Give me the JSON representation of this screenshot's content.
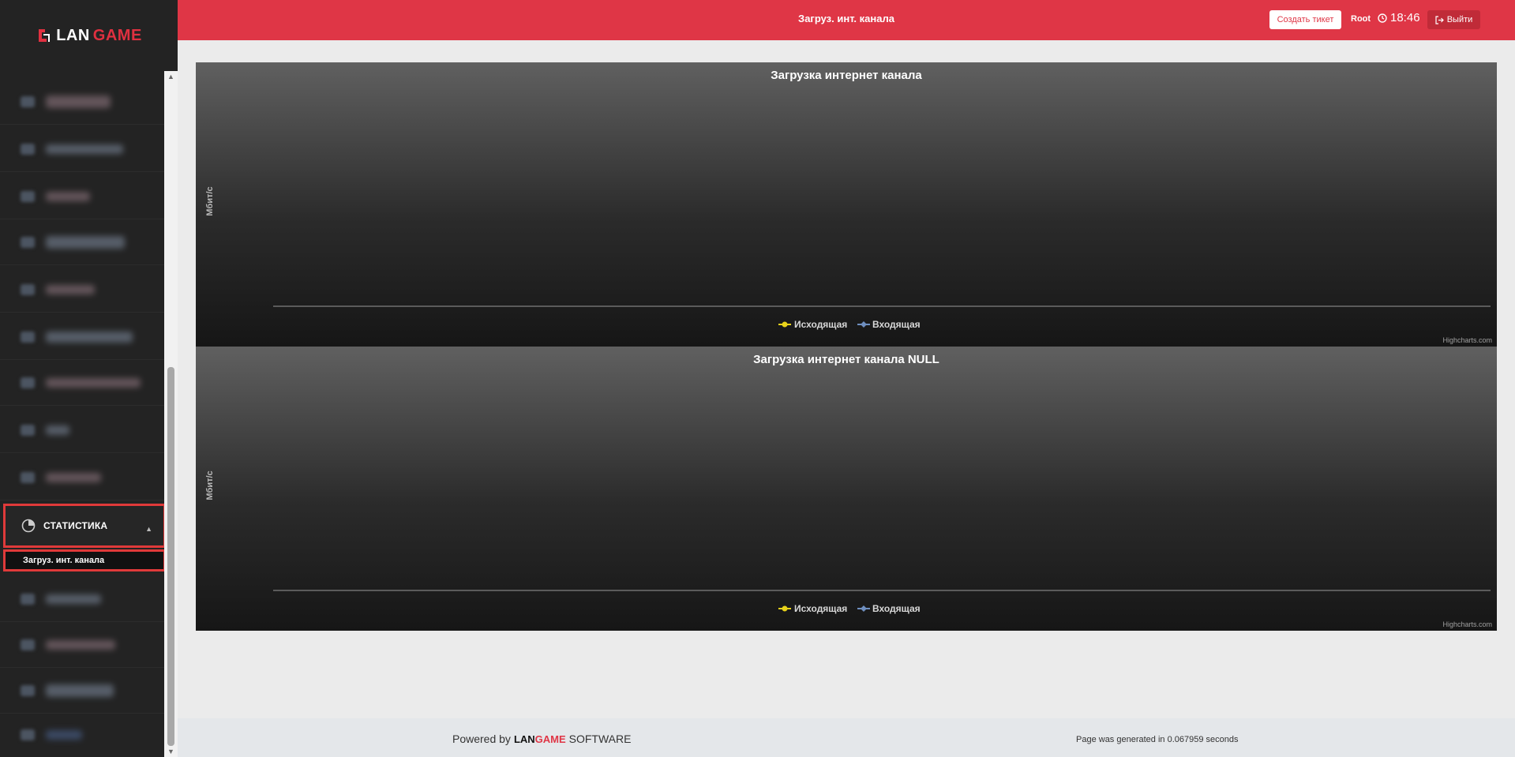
{
  "brand": {
    "lan": "LAN",
    "game": "GAME"
  },
  "header": {
    "title": "Загруз. инт. канала",
    "ticket_button": "Создать тикет",
    "user": "Root",
    "time": "18:46",
    "logout_button": "Выйти"
  },
  "sidebar": {
    "blurred_items": 9,
    "active_section": "СТАТИСТИКА",
    "active_subitem": "Загруз. инт. канала"
  },
  "chart_data": [
    {
      "type": "line",
      "title": "Загрузка интернет канала",
      "xlabel": "",
      "ylabel": "Мбит/с",
      "series": [
        {
          "name": "Исходящая",
          "values": [],
          "color": "#e8d21a"
        },
        {
          "name": "Входящая",
          "values": [],
          "color": "#6f8fc0"
        }
      ],
      "legend": "bottom-center",
      "credits": "Highcharts.com",
      "grid": false
    },
    {
      "type": "line",
      "title": "Загрузка интернет канала NULL",
      "xlabel": "",
      "ylabel": "Мбит/с",
      "series": [
        {
          "name": "Исходящая",
          "values": [],
          "color": "#e8d21a"
        },
        {
          "name": "Входящая",
          "values": [],
          "color": "#6f8fc0"
        }
      ],
      "legend": "bottom-center",
      "credits": "Highcharts.com",
      "grid": false
    }
  ],
  "footer": {
    "powered_prefix": "Powered by",
    "powered_lan": "LAN",
    "powered_game": "GAME",
    "powered_suffix": "SOFTWARE",
    "generated": "Page was generated in 0.067959 seconds"
  }
}
